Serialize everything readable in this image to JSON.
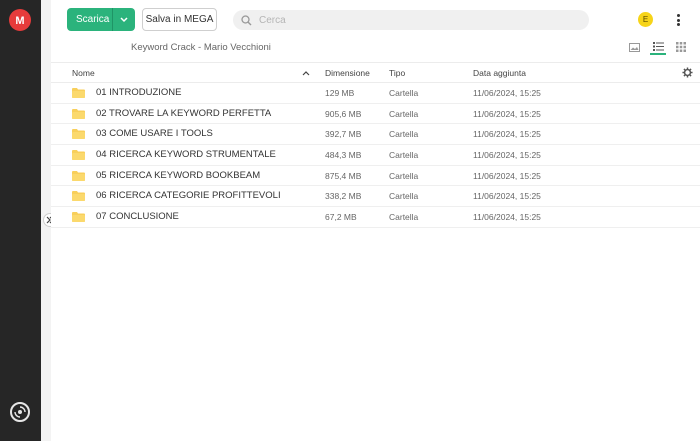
{
  "app": {
    "logo_letter": "M",
    "accent_color": "#2bb37c",
    "brand_color": "#e63b3b"
  },
  "toolbar": {
    "download_label": "Scarica",
    "save_label": "Salva in MEGA",
    "search_placeholder": "Cerca",
    "avatar_initial": "E"
  },
  "breadcrumb": "Keyword Crack - Mario Vecchioni",
  "table": {
    "headers": {
      "name": "Nome",
      "size": "Dimensione",
      "type": "Tipo",
      "date": "Data aggiunta"
    },
    "rows": [
      {
        "name": "01 INTRODUZIONE",
        "size": "129 MB",
        "type": "Cartella",
        "date": "11/06/2024, 15:25"
      },
      {
        "name": "02 TROVARE LA KEYWORD PERFETTA",
        "size": "905,6 MB",
        "type": "Cartella",
        "date": "11/06/2024, 15:25"
      },
      {
        "name": "03 COME USARE I TOOLS",
        "size": "392,7 MB",
        "type": "Cartella",
        "date": "11/06/2024, 15:25"
      },
      {
        "name": "04 RICERCA KEYWORD STRUMENTALE",
        "size": "484,3 MB",
        "type": "Cartella",
        "date": "11/06/2024, 15:25"
      },
      {
        "name": "05 RICERCA KEYWORD BOOKBEAM",
        "size": "875,4 MB",
        "type": "Cartella",
        "date": "11/06/2024, 15:25"
      },
      {
        "name": "06 RICERCA CATEGORIE PROFITTEVOLI",
        "size": "338,2 MB",
        "type": "Cartella",
        "date": "11/06/2024, 15:25"
      },
      {
        "name": "07 CONCLUSIONE",
        "size": "67,2 MB",
        "type": "Cartella",
        "date": "11/06/2024, 15:25"
      }
    ]
  },
  "icons": {
    "folder": "folder-icon",
    "search": "search-icon",
    "settings": "gear-icon",
    "sort": "chevron-up-icon"
  }
}
